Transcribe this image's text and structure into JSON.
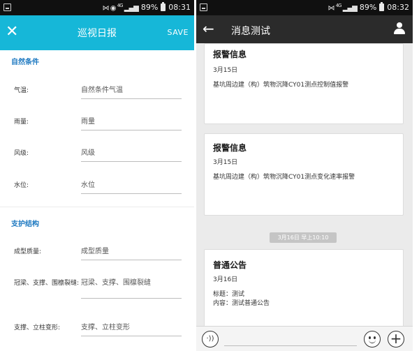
{
  "left": {
    "status": {
      "battery": "89%",
      "time": "08:31",
      "network": "4G"
    },
    "appbar": {
      "close_icon": "close-icon",
      "title": "巡视日报",
      "save": "SAVE"
    },
    "sections": [
      {
        "title": "自然条件",
        "fields": [
          {
            "label": "气温:",
            "placeholder": "自然条件气温"
          },
          {
            "label": "雨量:",
            "placeholder": "雨量"
          },
          {
            "label": "风级:",
            "placeholder": "风级"
          },
          {
            "label": "水位:",
            "placeholder": "水位"
          }
        ]
      },
      {
        "title": "支护结构",
        "fields": [
          {
            "label": "成型质量:",
            "placeholder": "成型质量"
          },
          {
            "label": "冠梁、支撑、围檩裂缝:",
            "placeholder": "冠梁、支撑、围檩裂缝"
          },
          {
            "label": "支撑、立柱变形:",
            "placeholder": "支撑、立柱变形"
          }
        ]
      }
    ]
  },
  "right": {
    "status": {
      "battery": "89%",
      "time": "08:32",
      "network": "4G"
    },
    "appbar": {
      "back_icon": "arrow-left-icon",
      "title": "消息测试",
      "profile_icon": "person-icon"
    },
    "messages": [
      {
        "title": "报警信息",
        "date": "3月15日",
        "body": "基坑周边建（构）筑物沉降CY01测点控制值报警"
      },
      {
        "title": "报警信息",
        "date": "3月15日",
        "body": "基坑周边建（构）筑物沉降CY01测点变化速率报警"
      },
      {
        "title": "普通公告",
        "date": "3月16日",
        "line1": "标题：测试",
        "line2": "内容：测试普通公告"
      }
    ],
    "time_divider": "3月16日 早上10:10",
    "inputbar": {
      "voice_icon": "voice-icon",
      "emoji_icon": "emoji-icon",
      "plus_icon": "plus-icon"
    }
  },
  "colors": {
    "left_accent": "#16b7d8",
    "right_header": "#2b2b2b",
    "section_title": "#1c78c0"
  }
}
